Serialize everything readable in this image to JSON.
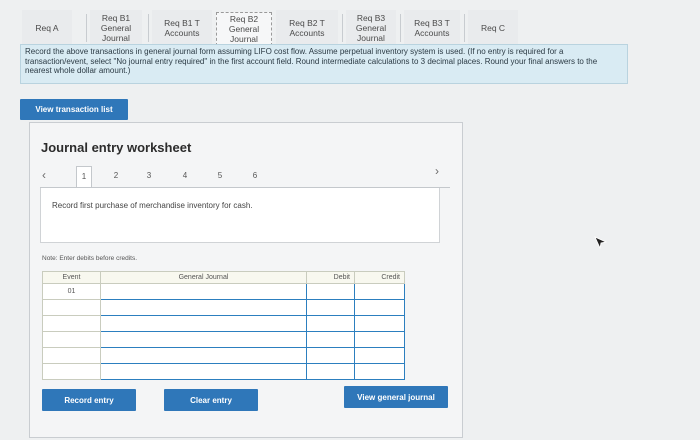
{
  "tabs": [
    {
      "label": "Req A",
      "active": false
    },
    {
      "label": "Req B1\nGeneral\nJournal",
      "active": false
    },
    {
      "label": "Req B1 T\nAccounts",
      "active": false
    },
    {
      "label": "Req B2\nGeneral\nJournal",
      "active": true
    },
    {
      "label": "Req B2 T\nAccounts",
      "active": false
    },
    {
      "label": "Req B3\nGeneral\nJournal",
      "active": false
    },
    {
      "label": "Req B3 T\nAccounts",
      "active": false
    },
    {
      "label": "Req C",
      "active": false
    }
  ],
  "instructions": "Record the above transactions in general journal form assuming LIFO cost flow. Assume perpetual inventory system is used. (If no entry is required for a transaction/event, select \"No journal entry required\" in the first account field. Round intermediate calculations to 3 decimal places. Round your final answers to the nearest whole dollar amount.)",
  "view_transaction_label": "View transaction list",
  "worksheet": {
    "title": "Journal entry worksheet",
    "pages": [
      "1",
      "2",
      "3",
      "4",
      "5",
      "6"
    ],
    "active_page": "1",
    "description": "Record first purchase of merchandise inventory for cash.",
    "note": "Note: Enter debits before credits.",
    "columns": {
      "event": "Event",
      "journal": "General Journal",
      "debit": "Debit",
      "credit": "Credit"
    },
    "first_event": "01"
  },
  "buttons": {
    "record_entry": "Record entry",
    "clear_entry": "Clear entry",
    "view_general_journal": "View general journal"
  }
}
